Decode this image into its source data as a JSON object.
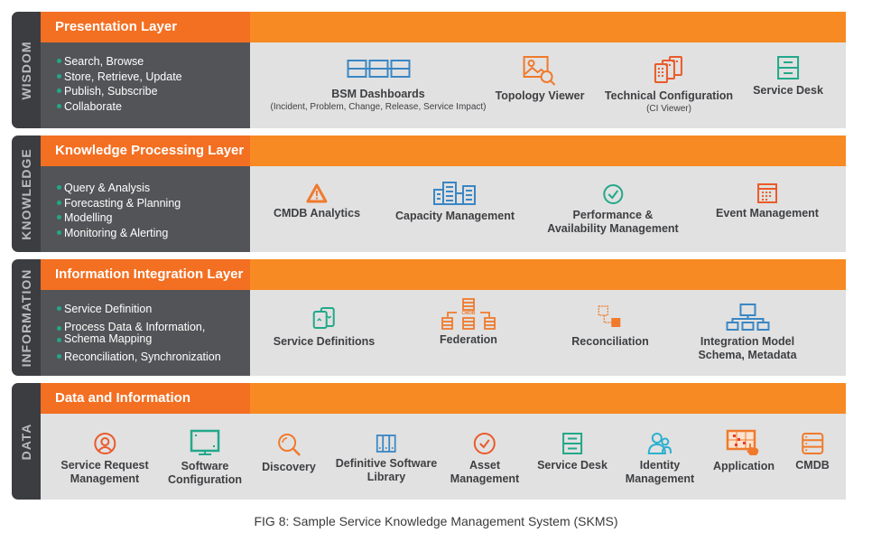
{
  "colors": {
    "side_bar": "#3c3d40",
    "bullet_panel": "#535457",
    "header_title": "#f36f22",
    "header_bar": "#f78a22",
    "items_panel": "#e1e1e1",
    "bullet_dot": "#22a88a",
    "icon_blue": "#3a86c4",
    "icon_orange": "#f07a2c",
    "icon_red_orange": "#ea5a2a",
    "icon_teal": "#22a88a"
  },
  "layers": [
    {
      "side_label": "WISDOM",
      "title": "Presentation Layer",
      "bullets": [
        "Search, Browse",
        "Store, Retrieve, Update",
        "Publish, Subscribe",
        "Collaborate"
      ],
      "items": [
        {
          "icon": "dashboard-panels-icon",
          "label": "BSM Dashboards",
          "sub": "(Incident, Problem, Change, Release, Service Impact)"
        },
        {
          "icon": "topology-image-search-icon",
          "label": "Topology Viewer",
          "sub": ""
        },
        {
          "icon": "stacked-documents-icon",
          "label": "Technical Configuration",
          "sub": "(CI Viewer)"
        },
        {
          "icon": "drawer-cabinet-icon",
          "label": "Service Desk",
          "sub": ""
        }
      ]
    },
    {
      "side_label": "KNOWLEDGE",
      "title": "Knowledge Processing Layer",
      "bullets": [
        "Query & Analysis",
        "Forecasting & Planning",
        "Modelling",
        "Monitoring & Alerting"
      ],
      "items": [
        {
          "icon": "warning-triangle-icon",
          "label": "CMDB Analytics"
        },
        {
          "icon": "buildings-icon",
          "label": "Capacity Management"
        },
        {
          "icon": "check-circle-icon",
          "label": "Performance &",
          "label2": "Availability Management"
        },
        {
          "icon": "calendar-icon",
          "label": "Event Management"
        }
      ]
    },
    {
      "side_label": "INFORMATION",
      "title": "Information Integration Layer",
      "bullets": [
        "Service Definition",
        "Process Data & Information,",
        "Schema Mapping",
        "Reconciliation, Synchronization"
      ],
      "items": [
        {
          "icon": "sync-documents-icon",
          "label": "Service Definitions"
        },
        {
          "icon": "federation-tree-icon",
          "label": "Federation",
          "icon_text": "CMDB"
        },
        {
          "icon": "reconciliation-link-icon",
          "label": "Reconciliation"
        },
        {
          "icon": "hierarchy-chart-icon",
          "label": "Integration Model",
          "label2": "Schema, Metadata"
        }
      ]
    },
    {
      "side_label": "DATA",
      "title": "Data and Information",
      "items": [
        {
          "icon": "user-circle-icon",
          "label": "Service Request",
          "label2": "Management"
        },
        {
          "icon": "monitor-icon",
          "label": "Software",
          "label2": "Configuration"
        },
        {
          "icon": "magnifier-icon",
          "label": "Discovery"
        },
        {
          "icon": "library-binders-icon",
          "label": "Definitive Software",
          "label2": "Library"
        },
        {
          "icon": "check-circle-icon",
          "label": "Asset",
          "label2": "Management"
        },
        {
          "icon": "drawer-cabinet-icon",
          "label": "Service Desk"
        },
        {
          "icon": "users-icon",
          "label": "Identity",
          "label2": "Management"
        },
        {
          "icon": "touch-screen-icon",
          "label": "Application"
        },
        {
          "icon": "database-stack-icon",
          "label": "CMDB"
        }
      ]
    }
  ],
  "caption": "FIG 8: Sample Service Knowledge Management System (SKMS)"
}
